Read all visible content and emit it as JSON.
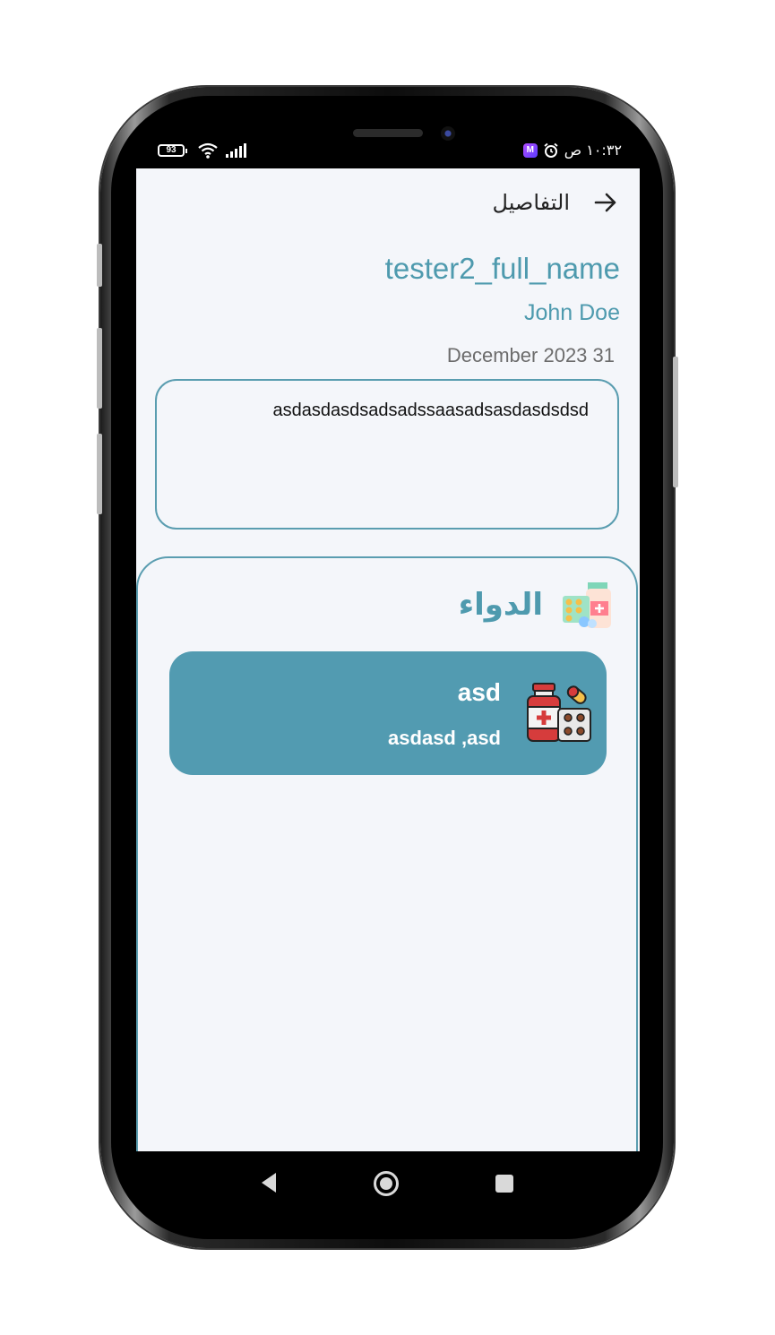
{
  "status_bar": {
    "battery": "93",
    "time": "١٠:٣٢ ص",
    "app_badge": "M"
  },
  "header": {
    "title": "التفاصيل"
  },
  "patient": {
    "full_name": "tester2_full_name",
    "doctor_name": "John Doe",
    "date": "December 2023 31"
  },
  "notes": {
    "text": "asdasdasdsadsadssaasadsasdasdsdsd"
  },
  "medicine": {
    "section_title": "الدواء",
    "items": [
      {
        "name": "asd",
        "detail": "asdasd ,asd"
      }
    ]
  },
  "colors": {
    "accent": "#4e9aae",
    "card": "#529bb1",
    "screen_bg": "#f4f6fa"
  }
}
